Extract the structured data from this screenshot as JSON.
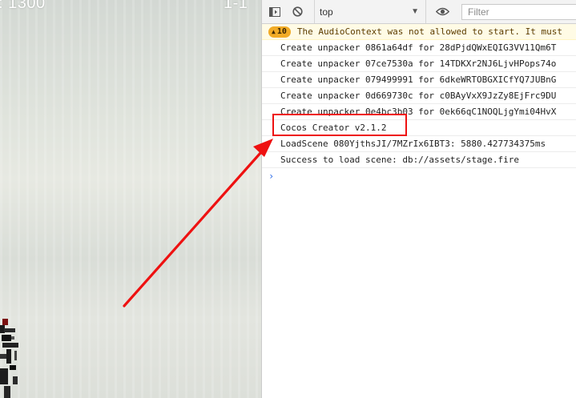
{
  "game": {
    "score_text": ": 1300",
    "level_text": "1-1"
  },
  "devtools": {
    "toolbar": {
      "context_value": "top",
      "filter_placeholder": "Filter"
    },
    "console": {
      "warning": {
        "count": "10",
        "message": "The AudioContext was not allowed to start. It must"
      },
      "messages": [
        "Create unpacker 0861a64df for 28dPjdQWxEQIG3VV11Qm6T",
        "Create unpacker 07ce7530a for 14TDKXr2NJ6LjvHPops74o",
        "Create unpacker 079499991 for 6dkeWRTOBGXICfYQ7JUBnG",
        "Create unpacker 0d669730c for c0BAyVxX9JzZy8EjFrc9DU",
        "Create unpacker 0e4bc3b03 for 0ek66qC1NOQLjgYmi04HvX",
        "Cocos Creator v2.1.2",
        "LoadScene 080YjthsJI/7MZrIx6IBT3: 5880.427734375ms",
        "Success to load scene: db://assets/stage.fire"
      ]
    }
  },
  "colors": {
    "annotation": "#ee1111",
    "warning_badge": "#f2ab26",
    "prompt": "#2f6ee8"
  }
}
